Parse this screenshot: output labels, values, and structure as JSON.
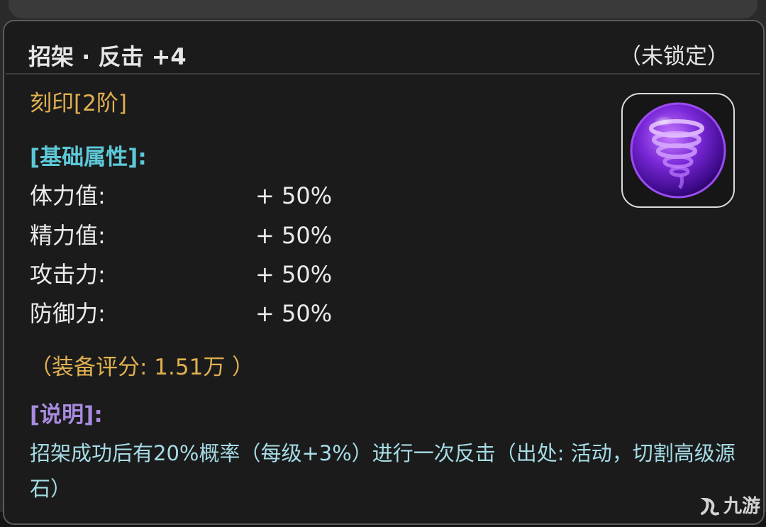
{
  "item": {
    "name": "招架 · 反击 +4",
    "lock_status": "（未锁定）",
    "rank": "刻印[2阶]",
    "icon": "purple-tornado-orb-icon"
  },
  "base_section": {
    "title": "[基础属性]:",
    "stats": [
      {
        "label": "体力值:",
        "value": "+ 50%"
      },
      {
        "label": "精力值:",
        "value": "+ 50%"
      },
      {
        "label": "攻击力:",
        "value": "+ 50%"
      },
      {
        "label": "防御力:",
        "value": "+ 50%"
      }
    ]
  },
  "score": "（装备评分: 1.51万 ）",
  "description": {
    "title": "[说明]:",
    "text": "招架成功后有20%概率（每级+3%）进行一次反击（出处: 活动，切割高级源石）"
  },
  "watermark": {
    "text": "九游",
    "icon": "jiuyou-logo-icon"
  },
  "colors": {
    "panel_bg": "#1b1b1b",
    "title": "#e6e6e6",
    "rank_gold": "#e0b050",
    "base_cyan": "#5dc8d8",
    "desc_purple": "#a98bdf",
    "desc_text": "#a6dce6"
  }
}
